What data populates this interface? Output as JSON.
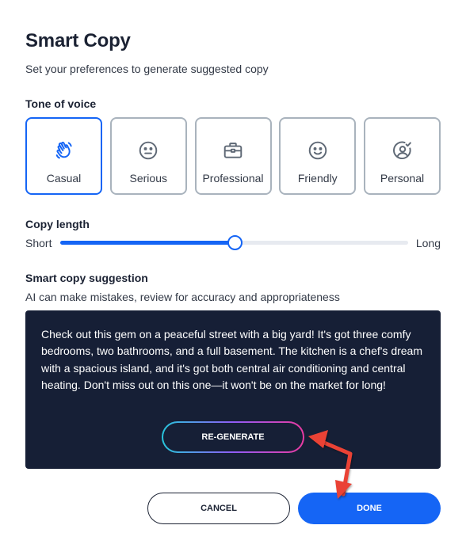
{
  "header": {
    "title": "Smart Copy",
    "subtitle": "Set your preferences to generate suggested copy"
  },
  "tone": {
    "label": "Tone of voice",
    "selected": "Casual",
    "options": [
      {
        "label": "Casual",
        "icon": "waving-hand-icon"
      },
      {
        "label": "Serious",
        "icon": "neutral-face-icon"
      },
      {
        "label": "Professional",
        "icon": "briefcase-icon"
      },
      {
        "label": "Friendly",
        "icon": "smile-face-icon"
      },
      {
        "label": "Personal",
        "icon": "person-check-icon"
      }
    ]
  },
  "copy_length": {
    "label": "Copy length",
    "min_label": "Short",
    "max_label": "Long",
    "value": 0.5
  },
  "suggestion": {
    "label": "Smart copy suggestion",
    "hint": "AI can make mistakes, review for accuracy and appropriateness",
    "text": "Check out this gem on a peaceful street with a big yard! It's got three comfy bedrooms, two bathrooms, and a full basement. The kitchen is a chef's dream with a spacious island, and it's got both central air conditioning and central heating. Don't miss out on this one—it won't be on the market for long!",
    "regenerate_label": "RE-GENERATE"
  },
  "actions": {
    "cancel_label": "CANCEL",
    "done_label": "DONE"
  },
  "colors": {
    "accent": "#1565f5",
    "dark_panel": "#161f36",
    "annotation_arrow": "#ea4335"
  }
}
